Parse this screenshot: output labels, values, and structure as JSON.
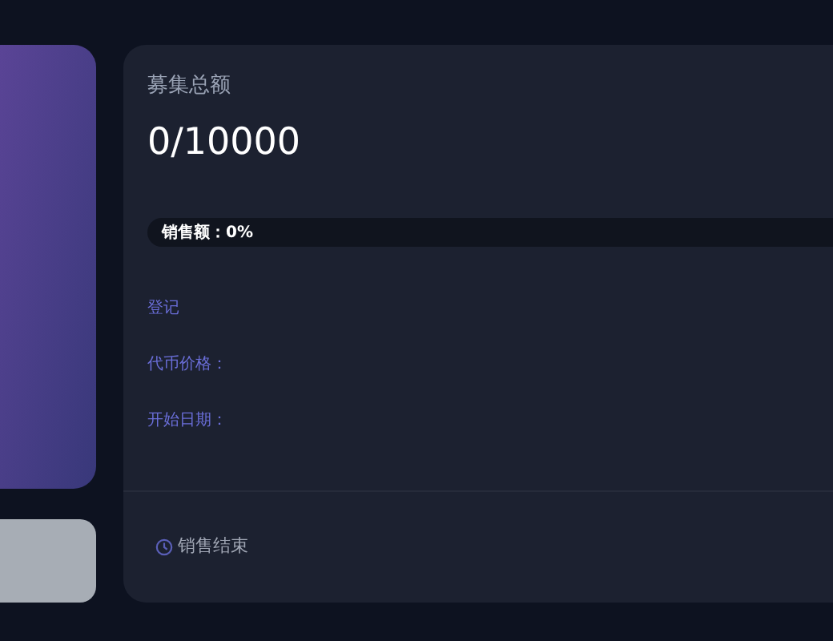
{
  "raise": {
    "title": "募集总额",
    "amount": "0/10000",
    "progress": {
      "label": "销售额：0%",
      "level": 0
    },
    "details": [
      {
        "label": "登记"
      },
      {
        "label": "代币价格："
      },
      {
        "label": "开始日期："
      }
    ],
    "status": "销售结束"
  }
}
